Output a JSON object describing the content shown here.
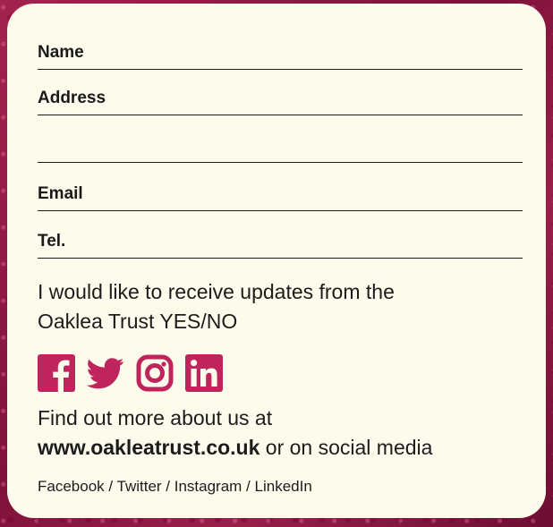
{
  "form": {
    "fields": [
      {
        "label": "Name"
      },
      {
        "label": "Address"
      },
      {
        "label": ""
      },
      {
        "label": "Email"
      },
      {
        "label": "Tel."
      }
    ]
  },
  "updates": {
    "line1": "I would like to receive updates from the",
    "line2": "Oaklea Trust YES/NO"
  },
  "social": {
    "icon_color": "#c0245c",
    "icons": [
      "facebook-icon",
      "twitter-icon",
      "instagram-icon",
      "linkedin-icon"
    ]
  },
  "more": {
    "line1": "Find out more about us at",
    "url": "www.oakleatrust.co.uk",
    "suffix": "or on social media"
  },
  "channels": "Facebook / Twitter / Instagram / LinkedIn",
  "colors": {
    "card": "#fdfbec",
    "background": "#8c1a44",
    "text": "#1c1c1c"
  }
}
